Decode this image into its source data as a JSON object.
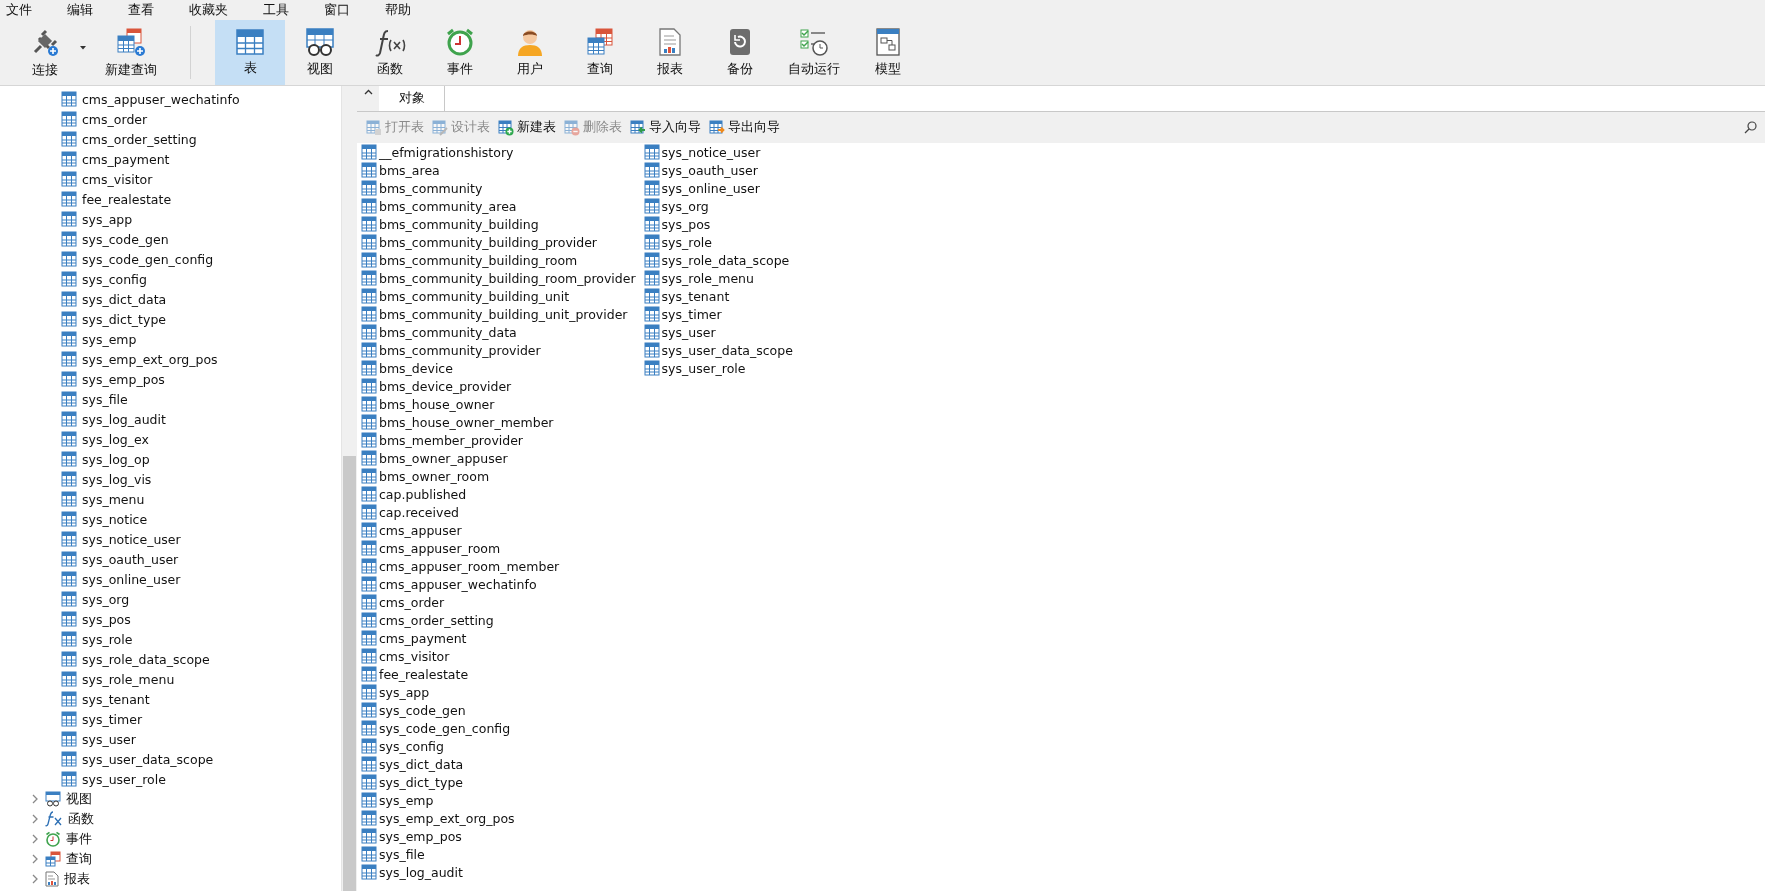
{
  "menu_bar": [
    "文件",
    "编辑",
    "查看",
    "收藏夹",
    "工具",
    "窗口",
    "帮助"
  ],
  "toolbar": [
    {
      "label": "连接",
      "kind": "connect",
      "selected": false
    },
    {
      "label": "新建查询",
      "kind": "new-query",
      "selected": false
    },
    {
      "label": "表",
      "kind": "table",
      "selected": true
    },
    {
      "label": "视图",
      "kind": "view",
      "selected": false
    },
    {
      "label": "函数",
      "kind": "function",
      "selected": false
    },
    {
      "label": "事件",
      "kind": "event",
      "selected": false
    },
    {
      "label": "用户",
      "kind": "user",
      "selected": false
    },
    {
      "label": "查询",
      "kind": "query",
      "selected": false
    },
    {
      "label": "报表",
      "kind": "report",
      "selected": false
    },
    {
      "label": "备份",
      "kind": "backup",
      "selected": false
    },
    {
      "label": "自动运行",
      "kind": "schedule",
      "selected": false
    },
    {
      "label": "模型",
      "kind": "model",
      "selected": false
    }
  ],
  "sidebar": {
    "tables": [
      "cms_appuser_wechatinfo",
      "cms_order",
      "cms_order_setting",
      "cms_payment",
      "cms_visitor",
      "fee_realestate",
      "sys_app",
      "sys_code_gen",
      "sys_code_gen_config",
      "sys_config",
      "sys_dict_data",
      "sys_dict_type",
      "sys_emp",
      "sys_emp_ext_org_pos",
      "sys_emp_pos",
      "sys_file",
      "sys_log_audit",
      "sys_log_ex",
      "sys_log_op",
      "sys_log_vis",
      "sys_menu",
      "sys_notice",
      "sys_notice_user",
      "sys_oauth_user",
      "sys_online_user",
      "sys_org",
      "sys_pos",
      "sys_role",
      "sys_role_data_scope",
      "sys_role_menu",
      "sys_tenant",
      "sys_timer",
      "sys_user",
      "sys_user_data_scope",
      "sys_user_role"
    ],
    "groups": [
      {
        "label": "视图",
        "kind": "view",
        "expanded": false
      },
      {
        "label": "函数",
        "kind": "function",
        "expanded": false
      },
      {
        "label": "事件",
        "kind": "event",
        "expanded": false
      },
      {
        "label": "查询",
        "kind": "query",
        "expanded": false
      },
      {
        "label": "报表",
        "kind": "report",
        "expanded": false
      }
    ]
  },
  "tabs": [
    {
      "label": "对象",
      "selected": true
    }
  ],
  "object_toolbar": [
    {
      "label": "打开表",
      "kind": "open",
      "disabled": true
    },
    {
      "label": "设计表",
      "kind": "design",
      "disabled": true
    },
    {
      "label": "新建表",
      "kind": "new",
      "disabled": false
    },
    {
      "label": "删除表",
      "kind": "delete",
      "disabled": true
    },
    {
      "label": "导入向导",
      "kind": "import",
      "disabled": false
    },
    {
      "label": "导出向导",
      "kind": "export",
      "disabled": false
    }
  ],
  "objects": {
    "columns": [
      [
        "__efmigrationshistory",
        "bms_area",
        "bms_community",
        "bms_community_area",
        "bms_community_building",
        "bms_community_building_provider",
        "bms_community_building_room",
        "bms_community_building_room_provider",
        "bms_community_building_unit",
        "bms_community_building_unit_provider",
        "bms_community_data",
        "bms_community_provider",
        "bms_device",
        "bms_device_provider",
        "bms_house_owner",
        "bms_house_owner_member",
        "bms_member_provider",
        "bms_owner_appuser",
        "bms_owner_room",
        "cap.published",
        "cap.received",
        "cms_appuser",
        "cms_appuser_room",
        "cms_appuser_room_member",
        "cms_appuser_wechatinfo",
        "cms_order",
        "cms_order_setting",
        "cms_payment",
        "cms_visitor",
        "fee_realestate",
        "sys_app",
        "sys_code_gen",
        "sys_code_gen_config",
        "sys_config",
        "sys_dict_data",
        "sys_dict_type",
        "sys_emp",
        "sys_emp_ext_org_pos",
        "sys_emp_pos",
        "sys_file",
        "sys_log_audit"
      ],
      [
        "sys_notice_user",
        "sys_oauth_user",
        "sys_online_user",
        "sys_org",
        "sys_pos",
        "sys_role",
        "sys_role_data_scope",
        "sys_role_menu",
        "sys_tenant",
        "sys_timer",
        "sys_user",
        "sys_user_data_scope",
        "sys_user_role"
      ]
    ]
  }
}
